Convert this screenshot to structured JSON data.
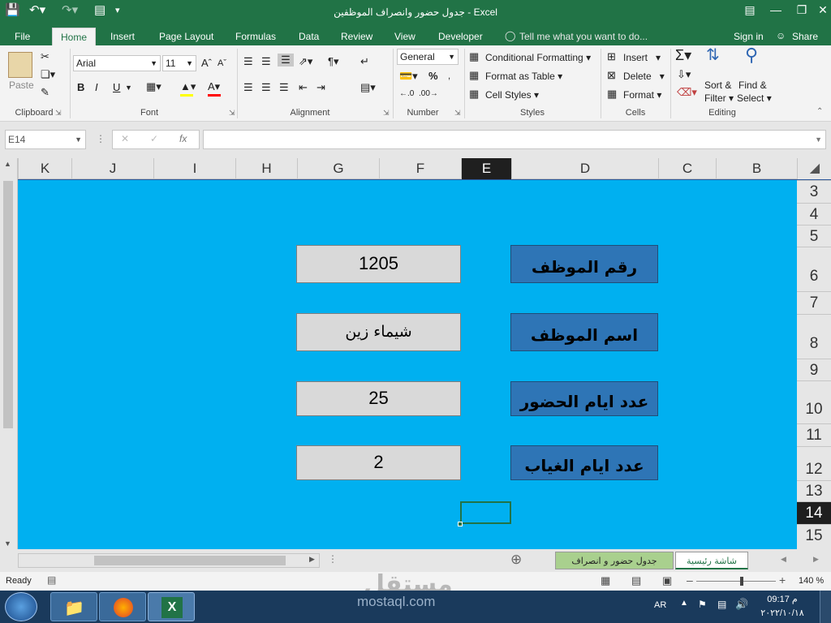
{
  "window": {
    "title": "جدول حضور وانصراف الموظفين - Excel",
    "controls": [
      "ribbon-display",
      "minimize",
      "restore",
      "close"
    ]
  },
  "quick_access": {
    "save": "save-icon",
    "undo": "undo-icon",
    "redo": "redo-icon"
  },
  "tabs": [
    {
      "label": "File",
      "active": false
    },
    {
      "label": "Home",
      "active": true
    },
    {
      "label": "Insert",
      "active": false
    },
    {
      "label": "Page Layout",
      "active": false
    },
    {
      "label": "Formulas",
      "active": false
    },
    {
      "label": "Data",
      "active": false
    },
    {
      "label": "Review",
      "active": false
    },
    {
      "label": "View",
      "active": false
    },
    {
      "label": "Developer",
      "active": false
    }
  ],
  "tell_me": "Tell me what you want to do...",
  "account": {
    "sign_in": "Sign in",
    "share": "Share"
  },
  "ribbon": {
    "clipboard": {
      "paste": "Paste",
      "label": "Clipboard"
    },
    "font": {
      "family": "Arial",
      "size": "11",
      "label": "Font",
      "bold": "B",
      "italic": "I",
      "underline": "U"
    },
    "alignment": {
      "label": "Alignment"
    },
    "number": {
      "format": "General",
      "percent": "%",
      "label": "Number"
    },
    "styles": {
      "conditional": "Conditional Formatting",
      "format_table": "Format as Table",
      "cell_styles": "Cell Styles",
      "label": "Styles"
    },
    "cells": {
      "insert": "Insert",
      "delete": "Delete",
      "format": "Format",
      "label": "Cells"
    },
    "editing": {
      "sort1": "Sort &",
      "sort2": "Filter",
      "find1": "Find &",
      "find2": "Select",
      "label": "Editing"
    }
  },
  "formula_bar": {
    "name_box": "E14",
    "fx": "fx",
    "content": ""
  },
  "columns": [
    "K",
    "J",
    "I",
    "H",
    "G",
    "F",
    "E",
    "D",
    "C",
    "B"
  ],
  "selected_column": "E",
  "rows": [
    "3",
    "4",
    "5",
    "6",
    "7",
    "8",
    "9",
    "10",
    "11",
    "12",
    "13",
    "14",
    "15"
  ],
  "selected_row": "14",
  "sheet_bg": "#00b0f0",
  "form": [
    {
      "label": "رقم الموظف",
      "value": "1205"
    },
    {
      "label": "اسم الموظف",
      "value": "شيماء زين"
    },
    {
      "label": "عدد ايام الحضور",
      "value": "25"
    },
    {
      "label": "عدد ايام الغياب",
      "value": "2"
    }
  ],
  "sheet_tabs": [
    {
      "label": "شاشة رئيسية",
      "active": true
    },
    {
      "label": "جدول حضور و انصراف",
      "active": false
    }
  ],
  "status": {
    "ready": "Ready",
    "zoom": "140 %"
  },
  "taskbar": {
    "lang": "AR",
    "time": "09:17 م",
    "date": "٢٠٢٢/١٠/١٨"
  },
  "watermark": {
    "logo": "مستقل",
    "site": "mostaql.com"
  }
}
